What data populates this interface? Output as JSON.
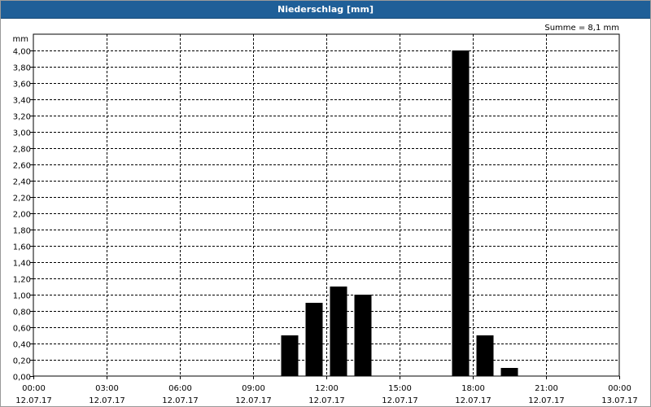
{
  "window": {
    "title": "Niederschlag [mm]"
  },
  "chart_data": {
    "type": "bar",
    "title": "Niederschlag [mm]",
    "ylabel": "mm",
    "summary": "Summe = 8,1 mm",
    "ylim": [
      0,
      4.2
    ],
    "yticks": [
      "0,00",
      "0,20",
      "0,40",
      "0,60",
      "0,80",
      "1,00",
      "1,20",
      "1,40",
      "1,60",
      "1,80",
      "2,00",
      "2,20",
      "2,40",
      "2,60",
      "2,80",
      "3,00",
      "3,20",
      "3,40",
      "3,60",
      "3,80",
      "4,00"
    ],
    "xticks": [
      {
        "time": "00:00",
        "date": "12.07.17"
      },
      {
        "time": "03:00",
        "date": "12.07.17"
      },
      {
        "time": "06:00",
        "date": "12.07.17"
      },
      {
        "time": "09:00",
        "date": "12.07.17"
      },
      {
        "time": "12:00",
        "date": "12.07.17"
      },
      {
        "time": "15:00",
        "date": "12.07.17"
      },
      {
        "time": "18:00",
        "date": "12.07.17"
      },
      {
        "time": "21:00",
        "date": "12.07.17"
      },
      {
        "time": "00:00",
        "date": "13.07.17"
      }
    ],
    "x_range": [
      "12.07.17 00:00",
      "13.07.17 00:00"
    ],
    "bar_interval": "1 h",
    "bars": [
      {
        "hour": 10,
        "value": 0.5
      },
      {
        "hour": 11,
        "value": 0.9
      },
      {
        "hour": 12,
        "value": 1.1
      },
      {
        "hour": 13,
        "value": 1.0
      },
      {
        "hour": 17,
        "value": 4.0
      },
      {
        "hour": 18,
        "value": 0.5
      },
      {
        "hour": 19,
        "value": 0.1
      }
    ],
    "grid": true,
    "bar_color": "#000000",
    "grid_color": "#000000"
  }
}
